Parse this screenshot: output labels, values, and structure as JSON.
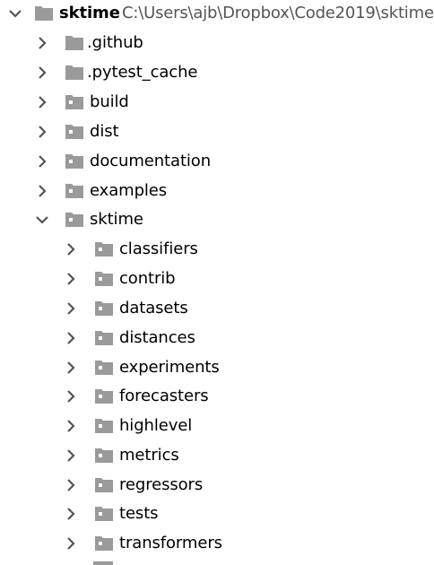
{
  "tree": {
    "root": {
      "label": "sktime",
      "path": "C:\\Users\\ajb\\Dropbox\\Code2019\\sktime",
      "expanded": true
    },
    "level1": [
      {
        "label": ".github",
        "expanded": false,
        "icon": "folder-icon"
      },
      {
        "label": ".pytest_cache",
        "expanded": false,
        "icon": "folder-icon"
      },
      {
        "label": "build",
        "expanded": false,
        "icon": "package-folder-icon"
      },
      {
        "label": "dist",
        "expanded": false,
        "icon": "package-folder-icon"
      },
      {
        "label": "documentation",
        "expanded": false,
        "icon": "package-folder-icon"
      },
      {
        "label": "examples",
        "expanded": false,
        "icon": "package-folder-icon"
      },
      {
        "label": "sktime",
        "expanded": true,
        "icon": "package-folder-icon"
      }
    ],
    "level2": [
      {
        "label": "classifiers",
        "expanded": false,
        "icon": "package-folder-icon"
      },
      {
        "label": "contrib",
        "expanded": false,
        "icon": "package-folder-icon"
      },
      {
        "label": "datasets",
        "expanded": false,
        "icon": "package-folder-icon"
      },
      {
        "label": "distances",
        "expanded": false,
        "icon": "package-folder-icon"
      },
      {
        "label": "experiments",
        "expanded": false,
        "icon": "package-folder-icon"
      },
      {
        "label": "forecasters",
        "expanded": false,
        "icon": "package-folder-icon"
      },
      {
        "label": "highlevel",
        "expanded": false,
        "icon": "package-folder-icon"
      },
      {
        "label": "metrics",
        "expanded": false,
        "icon": "package-folder-icon"
      },
      {
        "label": "regressors",
        "expanded": false,
        "icon": "package-folder-icon"
      },
      {
        "label": "tests",
        "expanded": false,
        "icon": "package-folder-icon"
      },
      {
        "label": "transformers",
        "expanded": false,
        "icon": "package-folder-icon"
      }
    ]
  },
  "colors": {
    "folder": "#9a9a9a",
    "folder_dot": "#ffffff",
    "chevron": "#555555",
    "text": "#000000",
    "path_text": "#555555"
  }
}
